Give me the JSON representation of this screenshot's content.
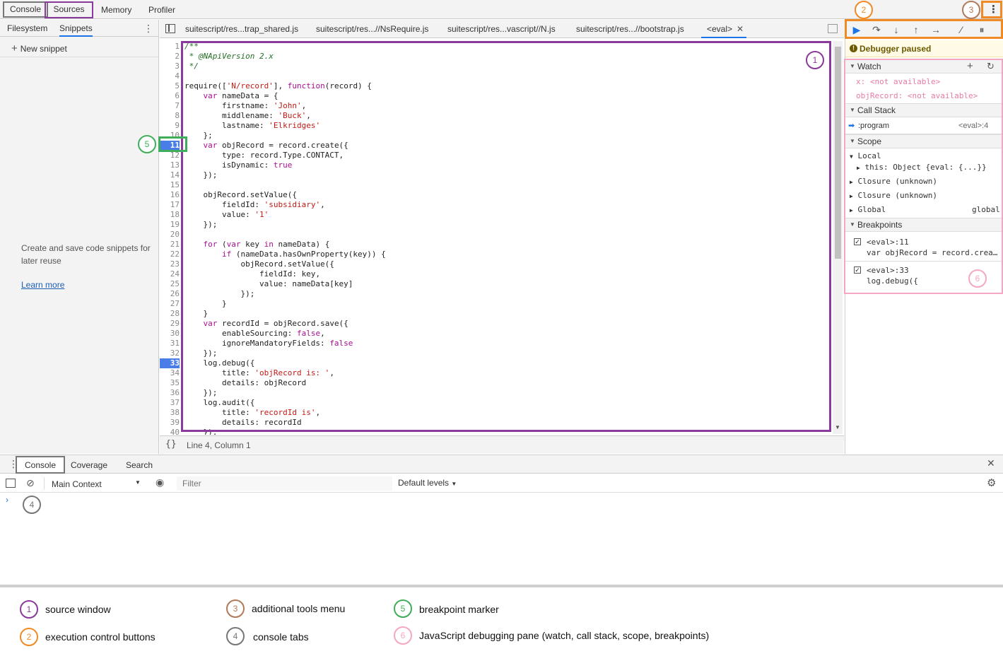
{
  "top_tabs": [
    "Console",
    "Sources",
    "Memory",
    "Profiler"
  ],
  "navigator": {
    "tabs": [
      "Filesystem",
      "Snippets"
    ],
    "new_snippet": "New snippet",
    "empty_text": "Create and save code snippets for later reuse",
    "learn_more": "Learn more"
  },
  "editor_tabs": [
    "suitescript/res...trap_shared.js",
    "suitescript/res...//NsRequire.js",
    "suitescript/res...vascript//N.js",
    "suitescript/res...//bootstrap.js",
    "<eval>"
  ],
  "code": {
    "lines": [
      "/**",
      " * @NApiVersion 2.x",
      " */",
      "",
      "require(['N/record'], function(record) {",
      "    var nameData = {",
      "        firstname: 'John',",
      "        middlename: 'Buck',",
      "        lastname: 'Elkridges'",
      "    };",
      "    var objRecord = record.create({",
      "        type: record.Type.CONTACT,",
      "        isDynamic: true",
      "    });",
      "",
      "    objRecord.setValue({",
      "        fieldId: 'subsidiary',",
      "        value: '1'",
      "    });",
      "",
      "    for (var key in nameData) {",
      "        if (nameData.hasOwnProperty(key)) {",
      "            objRecord.setValue({",
      "                fieldId: key,",
      "                value: nameData[key]",
      "            });",
      "        }",
      "    }",
      "    var recordId = objRecord.save({",
      "        enableSourcing: false,",
      "        ignoreMandatoryFields: false",
      "    });",
      "    log.debug({",
      "        title: 'objRecord is: ',",
      "        details: objRecord",
      "    });",
      "    log.audit({",
      "        title: 'recordId is',",
      "        details: recordId",
      "    });"
    ],
    "breakpoint_lines": [
      11,
      33
    ]
  },
  "status_text": "Line 4, Column 1",
  "debugger": {
    "paused": "Debugger paused",
    "watch_title": "Watch",
    "watch": [
      {
        "expr": "x:",
        "value": "<not available>"
      },
      {
        "expr": "objRecord:",
        "value": "<not available>"
      }
    ],
    "callstack_title": "Call Stack",
    "callstack": [
      {
        "name": ":program",
        "loc": "<eval>:4"
      }
    ],
    "scope_title": "Scope",
    "scope_local": "Local",
    "scope_this": "this: Object {eval: {...}}",
    "scope_closure1": "Closure (unknown)",
    "scope_closure2": "Closure (unknown)",
    "scope_global": "Global",
    "scope_global_value": "global",
    "breakpoints_title": "Breakpoints",
    "breakpoints": [
      {
        "loc": "<eval>:11",
        "code": "var objRecord = record.crea…"
      },
      {
        "loc": "<eval>:33",
        "code": "log.debug({"
      }
    ]
  },
  "drawer": {
    "tabs": [
      "Console",
      "Coverage",
      "Search"
    ],
    "context": "Main Context",
    "filter_placeholder": "Filter",
    "levels": "Default levels"
  },
  "legend": [
    {
      "num": "1",
      "text": "source window",
      "color": "#8a3a9a"
    },
    {
      "num": "2",
      "text": "execution control buttons",
      "color": "#f08a24"
    },
    {
      "num": "3",
      "text": "additional tools menu",
      "color": "#b07a5a"
    },
    {
      "num": "4",
      "text": "console tabs",
      "color": "#777777"
    },
    {
      "num": "5",
      "text": "breakpoint marker",
      "color": "#3fae5a"
    },
    {
      "num": "6",
      "text": "JavaScript debugging pane (watch, call stack, scope, breakpoints)",
      "color": "#f4a7c4"
    }
  ],
  "colors": {
    "accent_blue": "#1a73e8",
    "breakpoint_blue": "#4a7de8",
    "paused_banner_bg": "#fffbe6"
  }
}
